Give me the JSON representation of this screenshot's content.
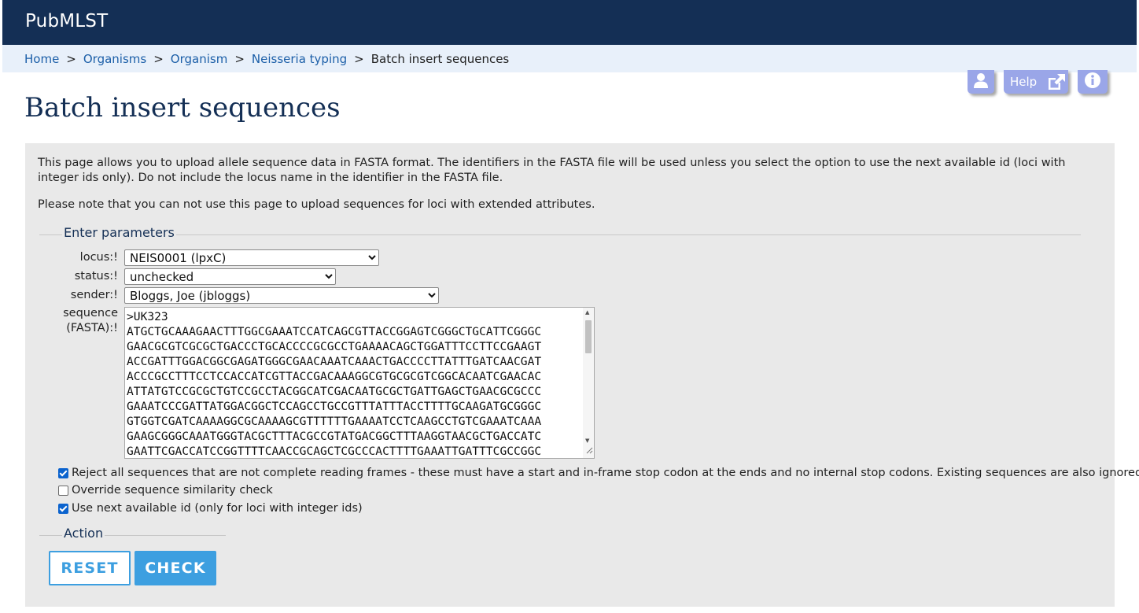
{
  "header": {
    "brand": "PubMLST"
  },
  "breadcrumb": [
    {
      "label": "Home"
    },
    {
      "label": "Organisms"
    },
    {
      "label": "Organism"
    },
    {
      "label": "Neisseria typing"
    },
    {
      "label": "Batch insert sequences"
    }
  ],
  "toolbar": {
    "help_label": "Help"
  },
  "page": {
    "title": "Batch insert sequences",
    "intro": "This page allows you to upload allele sequence data in FASTA format. The identifiers in the FASTA file will be used unless you select the option to use the next available id (loci with integer ids only). Do not include the locus name in the identifier in the FASTA file.",
    "note": "Please note that you can not use this page to upload sequences for loci with extended attributes."
  },
  "params": {
    "legend": "Enter parameters",
    "locus_label": "locus:!",
    "locus_value": "NEIS0001 (lpxC)",
    "status_label": "status:!",
    "status_value": "unchecked",
    "sender_label": "sender:!",
    "sender_value": "Bloggs, Joe (jbloggs)",
    "sequence_label_1": "sequence",
    "sequence_label_2": "(FASTA):!",
    "sequence_lines": [
      ">UK323",
      "ATGCTGCAAAGAACTTTGGCGAAATCCATCAGCGTTACCGGAGTCGGGCTGCATTCGGGC",
      "GAACGCGTCGCGCTGACCCTGCACCCCGCGCCTGAAAACAGCTGGATTTCCTTCCGAAGT",
      "ACCGATTTGGACGGCGAGATGGGCGAACAAATCAAACTGACCCCTTATTTGATCAACGAT",
      "ACCCGCCTTTCCTCCACCATCGTTACCGACAAAGGCGTGCGCGTCGGCACAATCGAACAC",
      "ATTATGTCCGCGCTGTCCGCCTACGGCATCGACAATGCGCTGATTGAGCTGAACGCGCCC",
      "GAAATCCCGATTATGGACGGCTCCAGCCTGCCGTTTATTTACCTTTTGCAAGATGCGGGC",
      "GTGGTCGATCAAAAGGCGCAAAAGCGTTTTTTGAAAATCCTCAAGCCTGTCGAAATCAAA",
      "GAAGCGGGCAAATGGGTACGCTTTACGCCGTATGACGGCTTTAAGGTAACGCTGACCATC",
      "GAATTCGACCATCCGGTTTTCAACCGCAGCTCGCCCACTTTTGAAATTGATTTCGCCGGC"
    ]
  },
  "options": {
    "reject_label": "Reject all sequences that are not complete reading frames - these must have a start and in-frame stop codon at the ends and no internal stop codons. Existing sequences are also ignored.",
    "reject_checked": true,
    "override_label": "Override sequence similarity check",
    "override_checked": false,
    "next_id_label": "Use next available id (only for loci with integer ids)",
    "next_id_checked": true
  },
  "action": {
    "legend": "Action",
    "reset_label": "RESET",
    "check_label": "CHECK"
  },
  "colors": {
    "header_bg": "#142f55",
    "breadcrumb_bg": "#e8f0fa",
    "link": "#1c5fa8",
    "tool_button": "#9aa6e8",
    "action_blue": "#3d9fe0",
    "panel_bg": "#e9e9e9"
  }
}
